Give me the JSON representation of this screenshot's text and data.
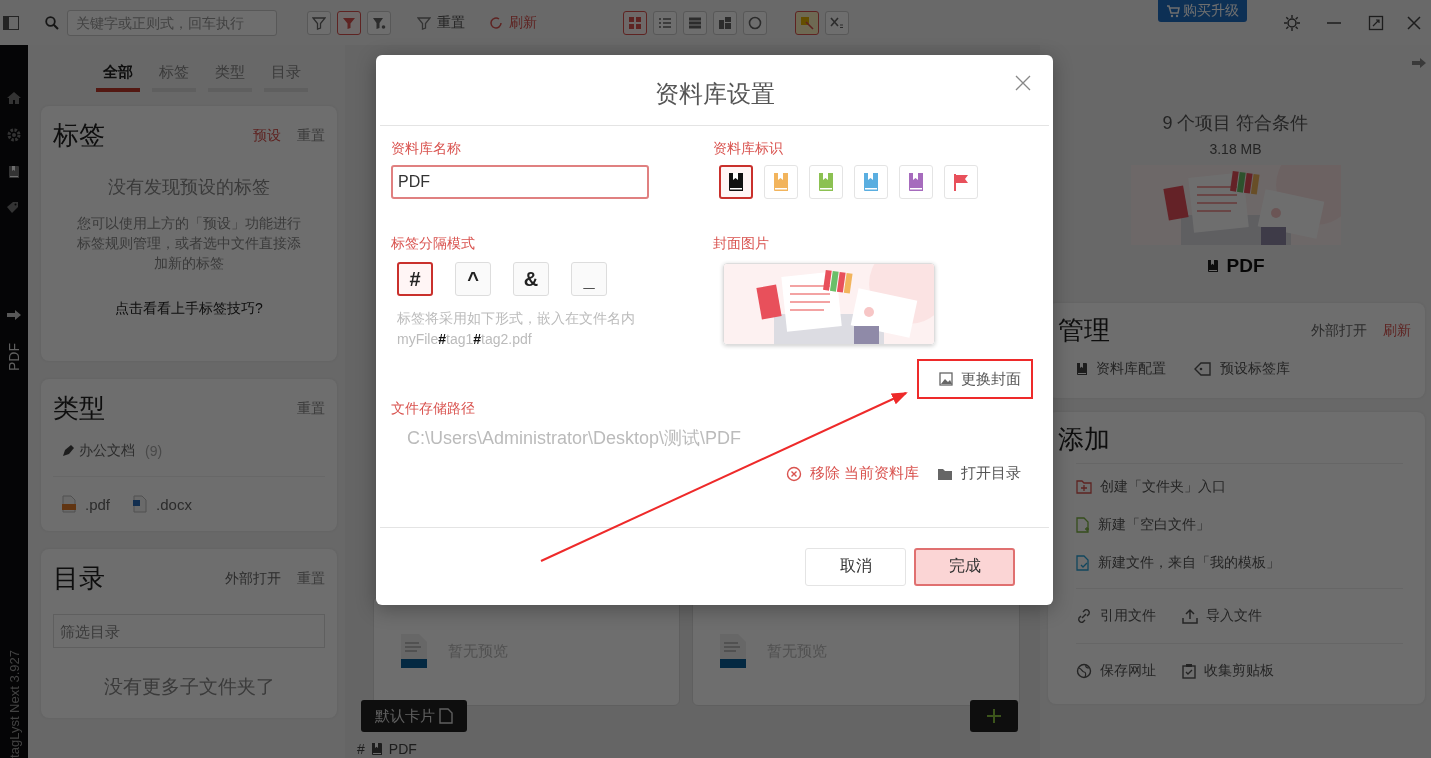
{
  "toolbar": {
    "search": {
      "placeholder": "关键字或正则式，回车执行"
    },
    "filter_buttons": [
      {
        "selected": false
      },
      {
        "selected": true
      },
      {
        "selected": false
      }
    ],
    "reset": "重置",
    "refresh": "刷新",
    "view_buttons": [
      {
        "selected": true
      },
      {
        "selected": false
      },
      {
        "selected": false
      },
      {
        "selected": false
      },
      {
        "selected": false
      }
    ],
    "extra_buttons": [
      {
        "selected": true
      },
      {
        "selected": false
      }
    ],
    "upgrade": "购买升级"
  },
  "rail": {
    "library": "PDF",
    "version": "tagLyst Next 3.927"
  },
  "left_panel": {
    "tabs": [
      {
        "label": "全部",
        "selected": true
      },
      {
        "label": "标签",
        "selected": false
      },
      {
        "label": "类型",
        "selected": false
      },
      {
        "label": "目录",
        "selected": false
      }
    ],
    "tags_card": {
      "title": "标签",
      "preset": "预设",
      "reset": "重置",
      "empty_title": "没有发现预设的标签",
      "empty_text": "您可以使用上方的「预设」功能进行标签规则管理，或者选中文件直接添加新的标签",
      "tips_link": "点击看看上手标签技巧?"
    },
    "types_card": {
      "title": "类型",
      "reset": "重置",
      "category": {
        "label": "办公文档",
        "count": "(9)"
      },
      "extensions": [
        {
          "label": ".pdf",
          "kind": "pdf"
        },
        {
          "label": ".docx",
          "kind": "docx"
        }
      ]
    },
    "folders_card": {
      "title": "目录",
      "open_external": "外部打开",
      "reset": "重置",
      "filter": {
        "placeholder": "筛选目录"
      },
      "empty_text": "没有更多子文件夹了"
    }
  },
  "center": {
    "cards": [
      {
        "preview": "暂无预览"
      },
      {
        "preview": "暂无预览"
      }
    ],
    "card_style_button": "默认卡片",
    "footer": {
      "hash": "#",
      "library": "PDF"
    }
  },
  "right_panel": {
    "summary": "9 个项目 符合条件",
    "size": "3.18 MB",
    "library_name": "PDF",
    "manage": {
      "title": "管理",
      "open_external": "外部打开",
      "refresh": "刷新",
      "items": [
        {
          "label": "资料库配置",
          "kind": "library"
        },
        {
          "label": "预设标签库",
          "kind": "tag"
        }
      ]
    },
    "add": {
      "title": "添加",
      "groups": [
        {
          "items": [
            {
              "label": "创建「文件夹」入口",
              "kind": "folder-entry"
            },
            {
              "label": "新建「空白文件」",
              "kind": "blank-file"
            },
            {
              "label": "新建文件，来自「我的模板」",
              "kind": "template"
            }
          ]
        },
        {
          "items": [
            {
              "label": "引用文件",
              "kind": "link"
            },
            {
              "label": "导入文件",
              "kind": "import"
            }
          ]
        },
        {
          "items": [
            {
              "label": "保存网址",
              "kind": "web"
            },
            {
              "label": "收集剪贴板",
              "kind": "clipboard"
            }
          ]
        }
      ]
    }
  },
  "dialog": {
    "title": "资料库设置",
    "name_label": "资料库名称",
    "name_value": "PDF",
    "mark_label": "资料库标识",
    "marks": [
      {
        "kind": "book",
        "color": "#111111",
        "selected": true
      },
      {
        "kind": "book",
        "color": "#f2b45c",
        "selected": false
      },
      {
        "kind": "book",
        "color": "#8cc152",
        "selected": false
      },
      {
        "kind": "book",
        "color": "#5aaee0",
        "selected": false
      },
      {
        "kind": "book",
        "color": "#a66bbd",
        "selected": false
      },
      {
        "kind": "flag",
        "color": "#e8505b",
        "selected": false
      }
    ],
    "separator_label": "标签分隔模式",
    "separators": [
      {
        "symbol": "#",
        "selected": true
      },
      {
        "symbol": "^",
        "selected": false
      },
      {
        "symbol": "&",
        "selected": false
      },
      {
        "symbol": "_",
        "selected": false
      }
    ],
    "separator_hint": "标签将采用如下形式，嵌入在文件名内",
    "separator_example": "myFile**#**tag1**#**tag2.pdf",
    "cover_label": "封面图片",
    "change_cover": "更换封面",
    "path_label": "文件存储路径",
    "path": "C:\\Users\\Administrator\\Desktop\\测试\\PDF",
    "remove": "移除 当前资料库",
    "open_folder": "打开目录",
    "cancel": "取消",
    "done": "完成"
  }
}
